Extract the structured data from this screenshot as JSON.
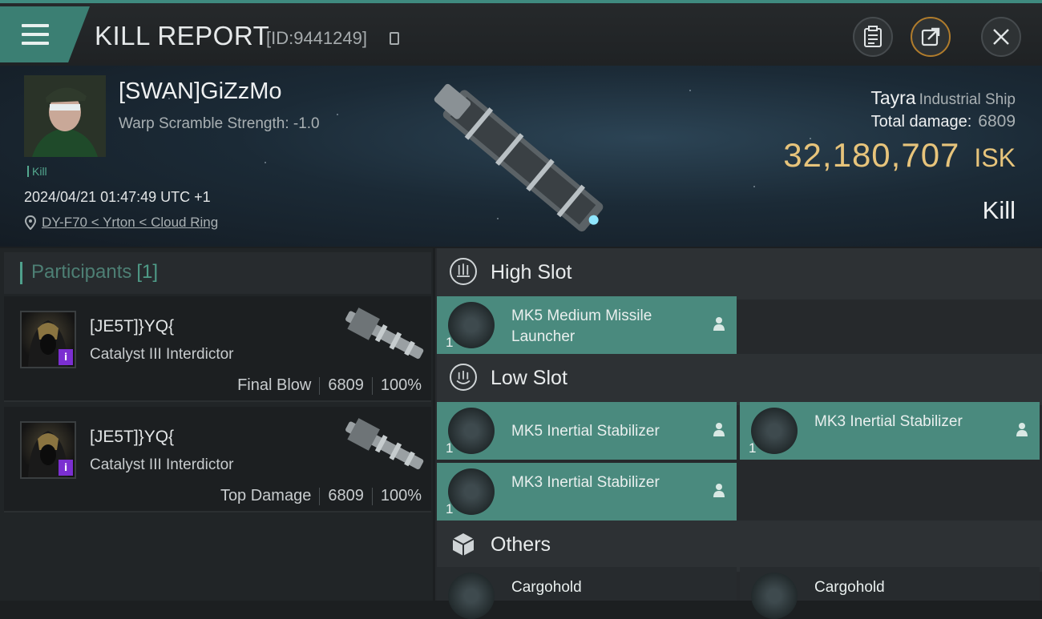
{
  "header": {
    "title": "KILL REPORT",
    "report_id": "[ID:9441249]"
  },
  "header_buttons": [
    {
      "name": "report-log-button",
      "icon": "clipboard-icon"
    },
    {
      "name": "share-button",
      "icon": "share-icon"
    },
    {
      "name": "close-button",
      "icon": "close-icon"
    }
  ],
  "victim": {
    "name": "[SWAN]GiZzMo",
    "warp_scramble": "Warp Scramble Strength: -1.0",
    "tag": "Kill",
    "datetime": "2024/04/21 01:47:49 UTC +1",
    "location": "DY-F70 < Yrton < Cloud Ring",
    "ship_name": "Tayra",
    "ship_class": "Industrial Ship",
    "total_damage_label": "Total damage:",
    "total_damage": "6809",
    "isk_value": "32,180,707",
    "isk_unit": "ISK",
    "result": "Kill"
  },
  "participants": {
    "label": "Participants",
    "count": "[1]",
    "items": [
      {
        "name": "[JE5T]}YQ{",
        "ship": "Catalyst III Interdictor",
        "role": "Final Blow",
        "damage": "6809",
        "percent": "100%",
        "badge": "i"
      },
      {
        "name": "[JE5T]}YQ{",
        "ship": "Catalyst III Interdictor",
        "role": "Top Damage",
        "damage": "6809",
        "percent": "100%",
        "badge": "i"
      }
    ]
  },
  "slots": {
    "high": {
      "label": "High Slot",
      "modules": [
        {
          "name": "MK5 Medium Missile Launcher",
          "qty": "1"
        }
      ]
    },
    "low": {
      "label": "Low Slot",
      "modules": [
        {
          "name": "MK5 Inertial Stabilizer",
          "qty": "1"
        },
        {
          "name": "MK3 Inertial Stabilizer",
          "qty": "1"
        },
        {
          "name": "MK3 Inertial Stabilizer",
          "qty": "1"
        }
      ]
    },
    "others": {
      "label": "Others",
      "modules": [
        {
          "name": "Cargohold"
        },
        {
          "name": "Cargohold"
        }
      ]
    }
  },
  "colors": {
    "accent": "#3b7f73",
    "module_bg": "#4a8a7e",
    "isk": "#e7c47b",
    "badge": "#7b2fd1"
  }
}
